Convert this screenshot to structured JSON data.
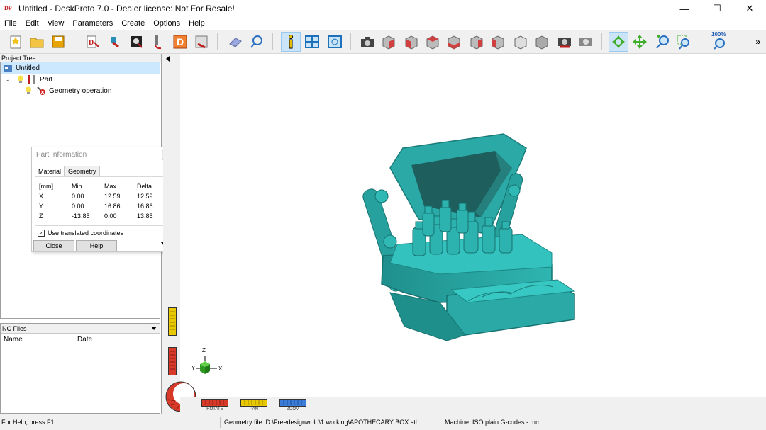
{
  "window": {
    "title": "Untitled - DeskProto 7.0 - Dealer license: Not For Resale!",
    "app_icon_text": "DP",
    "minimize": "—",
    "maximize": "☐",
    "close": "✕"
  },
  "menu": [
    "File",
    "Edit",
    "View",
    "Parameters",
    "Create",
    "Options",
    "Help"
  ],
  "toolbar": {
    "zoom_percent": "100%",
    "more": "»"
  },
  "project_tree": {
    "header": "Project Tree",
    "items": [
      {
        "label": "Untitled",
        "selected": true
      },
      {
        "label": "Part"
      },
      {
        "label": "Geometry operation"
      }
    ]
  },
  "nc_files": {
    "header": "NC Files",
    "columns": [
      "Name",
      "Date"
    ]
  },
  "part_info": {
    "title": "Part Information",
    "tabs": [
      "Material",
      "Geometry"
    ],
    "active_tab": "Material",
    "headers": [
      "[mm]",
      "Min",
      "Max",
      "Delta"
    ],
    "rows": [
      {
        "axis": "X",
        "min": "0.00",
        "max": "12.59",
        "delta": "12.59"
      },
      {
        "axis": "Y",
        "min": "0.00",
        "max": "16.86",
        "delta": "16.86"
      },
      {
        "axis": "Z",
        "min": "-13.85",
        "max": "0.00",
        "delta": "13.85"
      }
    ],
    "checkbox_label": "Use translated coordinates",
    "checkbox_checked": true,
    "close_label": "Close",
    "help_label": "Help"
  },
  "viewport": {
    "axis_labels": {
      "z": "Z",
      "y": "Y",
      "x": "X"
    },
    "dials": [
      "ROTATE",
      "PAN",
      "ZOOM"
    ],
    "model_color": "#2aa9a6"
  },
  "status": {
    "help": "For Help, press F1",
    "geometry_file": "Geometry file: D:\\Freedesignwold\\1.working\\APOTHECARY BOX.stl",
    "machine": "Machine: ISO plain G-codes - mm"
  }
}
